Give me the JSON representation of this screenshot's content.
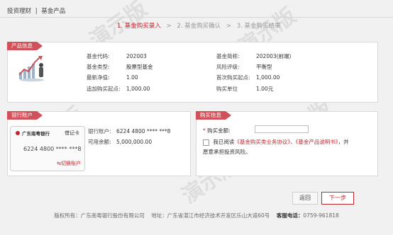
{
  "breadcrumb": {
    "root": "投资理财",
    "sep": "|",
    "current": "基金产品"
  },
  "steps": [
    {
      "label": "1. 基金购买录入"
    },
    {
      "label": "2. 基金购买确认"
    },
    {
      "label": "3. 基金购买结果"
    }
  ],
  "step_arrow": ">",
  "product": {
    "tab": "产品信息",
    "code_label": "基金代码:",
    "code": "202003",
    "name_label": "基金简称:",
    "name": "202003(前端)",
    "type_label": "基金类型:",
    "type": "股票型基金",
    "risk_label": "风险评级:",
    "risk": "平衡型",
    "nav_label": "最新净值:",
    "nav": "1.00",
    "first_min_label": "首次购买起点:",
    "first_min": "1,000.00",
    "add_min_label": "追加购买起点:",
    "add_min": "1,000.00",
    "unit_label": "购买单位",
    "unit": "1.00元"
  },
  "account": {
    "tab": "银行账户",
    "bank_name": "广东南粤银行",
    "card_type": "借记卡",
    "card_number": "6224 4800 **** ***8",
    "acct_label": "银行账户:",
    "acct": "6224 4800 **** ***8",
    "balance_label": "可用余额:",
    "balance": "5,000,000.00",
    "switch_label": "切换账户"
  },
  "purchase": {
    "tab": "购买信息",
    "required_mark": "*",
    "amount_label": "购买金额:",
    "amount_value": "",
    "agree_prefix": "我已阅读",
    "agreement1": "《基金购买类业务协议》",
    "sep": "、",
    "agreement2": "《基金产品说明书》",
    "agree_suffix": "，并",
    "agree_line2": "愿意承担投资风险。"
  },
  "buttons": {
    "back": "返回",
    "next": "下一步"
  },
  "footer": {
    "copyright": "版权所有：广东南粤银行股份有限公司",
    "address": "地址：广东省湛江市经济技术开发区乐山大道60号",
    "hotline_label": "客服电话：",
    "hotline": "0759-961818"
  },
  "watermark": "演示版",
  "colors": {
    "accent": "#c0272d",
    "tab": "#d0515a"
  }
}
